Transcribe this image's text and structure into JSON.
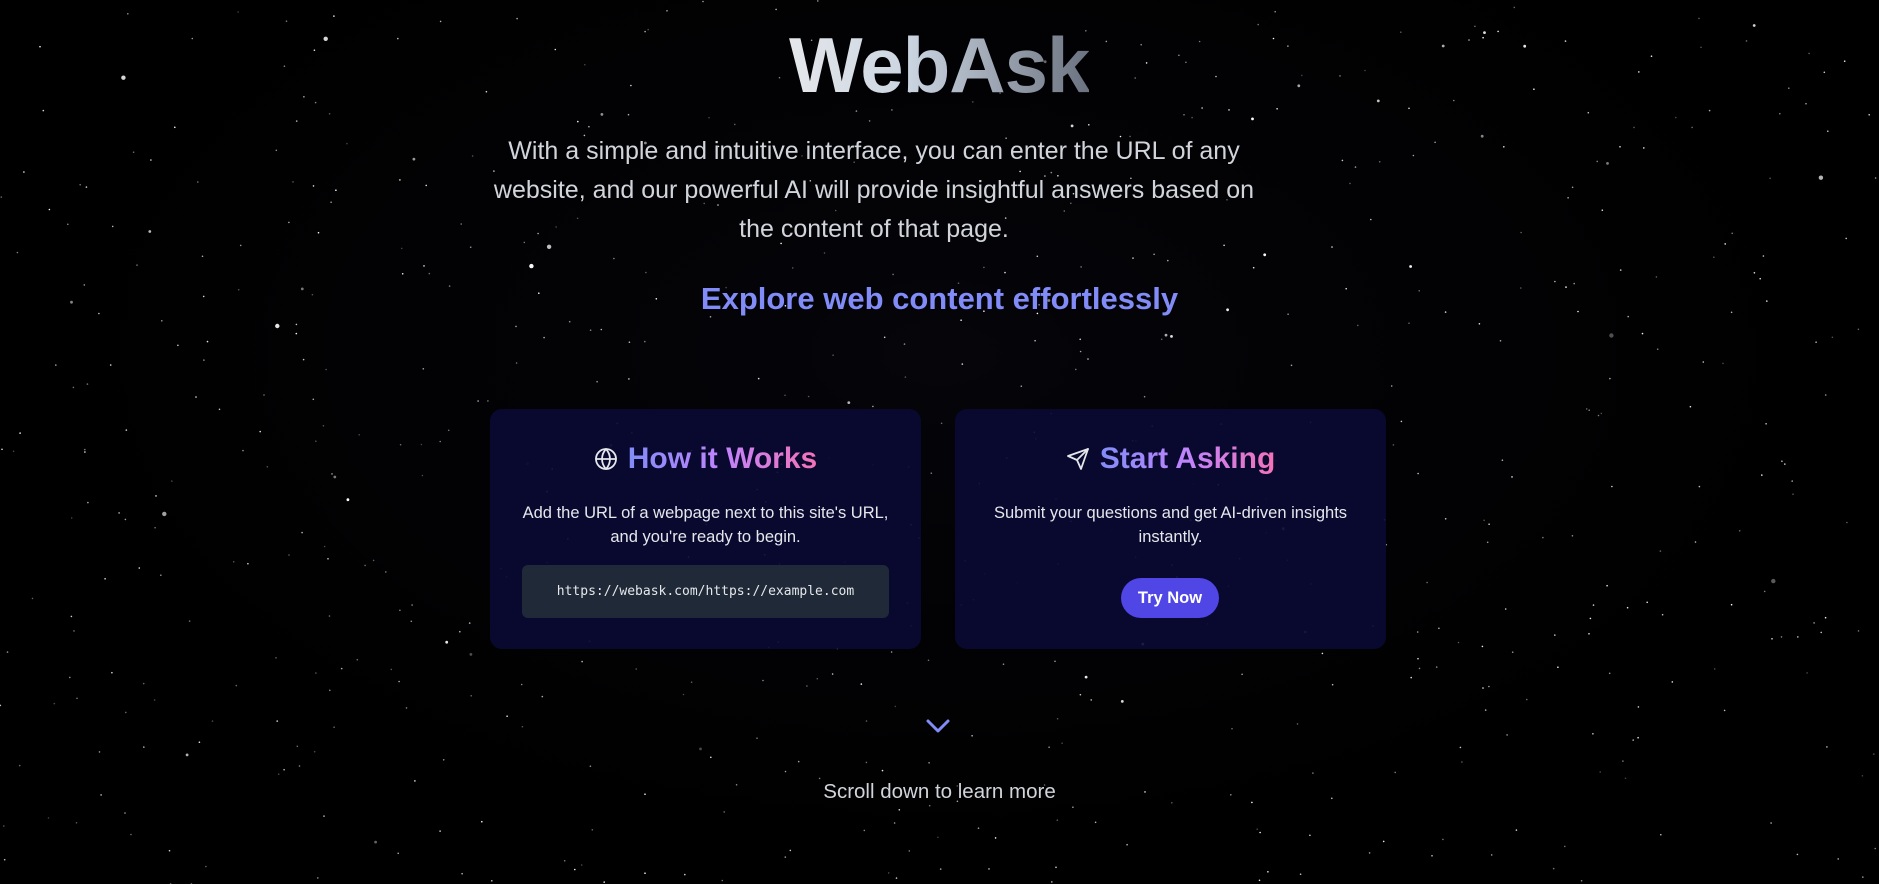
{
  "app": {
    "title": "WebAsk",
    "description": "With a simple and intuitive interface, you can enter the URL of any website, and our powerful AI will provide insightful answers based on the content of that page.",
    "tagline": "Explore web content effortlessly"
  },
  "cards": {
    "how_it_works": {
      "icon": "globe-icon",
      "title": "How it Works",
      "text": "Add the URL of a webpage next to this site's URL, and you're ready to begin.",
      "example_url": "https://webask.com/https://example.com"
    },
    "start_asking": {
      "icon": "send-icon",
      "title": "Start Asking",
      "text": "Submit your questions and get AI-driven insights instantly.",
      "button_label": "Try Now"
    }
  },
  "scroll": {
    "icon": "chevron-down-icon",
    "text": "Scroll down to learn more"
  },
  "colors": {
    "background": "#000000",
    "accent": "#818cf8",
    "button": "#4f46e5",
    "card_background": "#0a0a34",
    "gradient_pink": "#f472b6"
  }
}
